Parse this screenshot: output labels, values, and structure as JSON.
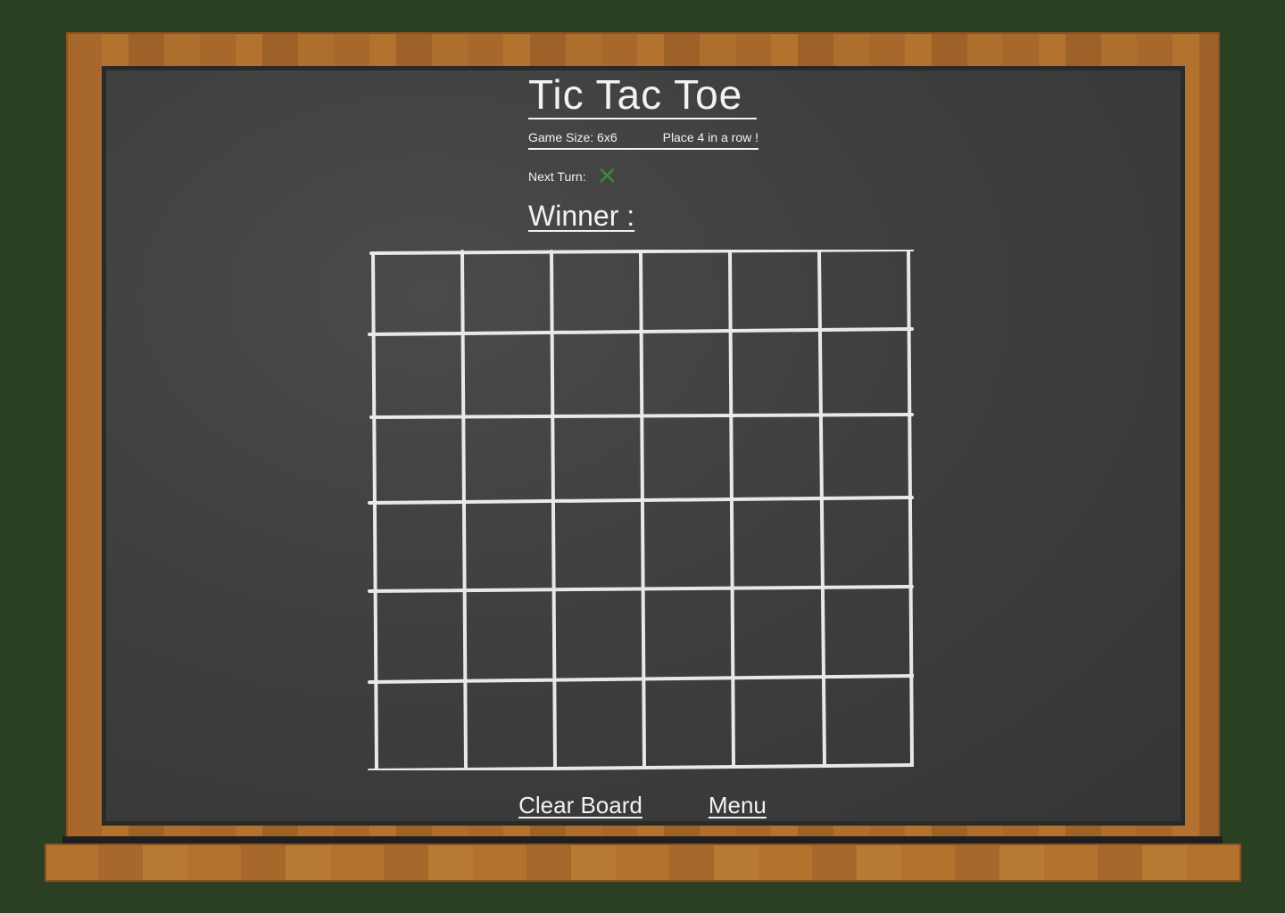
{
  "game": {
    "title": "Tic Tac Toe",
    "size_label": "Game Size: 6x6",
    "goal_label": "Place 4 in a row !",
    "next_turn_label": "Next Turn:",
    "next_turn_mark": "✕",
    "winner_label": "Winner :",
    "winner_value": ""
  },
  "board": {
    "rows": 6,
    "cols": 6,
    "cells": [
      [
        "",
        "",
        "",
        "",
        "",
        ""
      ],
      [
        "",
        "",
        "",
        "",
        "",
        ""
      ],
      [
        "",
        "",
        "",
        "",
        "",
        ""
      ],
      [
        "",
        "",
        "",
        "",
        "",
        ""
      ],
      [
        "",
        "",
        "",
        "",
        "",
        ""
      ],
      [
        "",
        "",
        "",
        "",
        "",
        ""
      ]
    ]
  },
  "actions": {
    "clear_label": "Clear Board",
    "menu_label": "Menu"
  },
  "colors": {
    "background": "#2b4023",
    "chalkboard": "#3f3f3f",
    "frame_wood": "#a8682c",
    "chalk": "#f2f2f2",
    "x_mark": "#2f8a43"
  }
}
